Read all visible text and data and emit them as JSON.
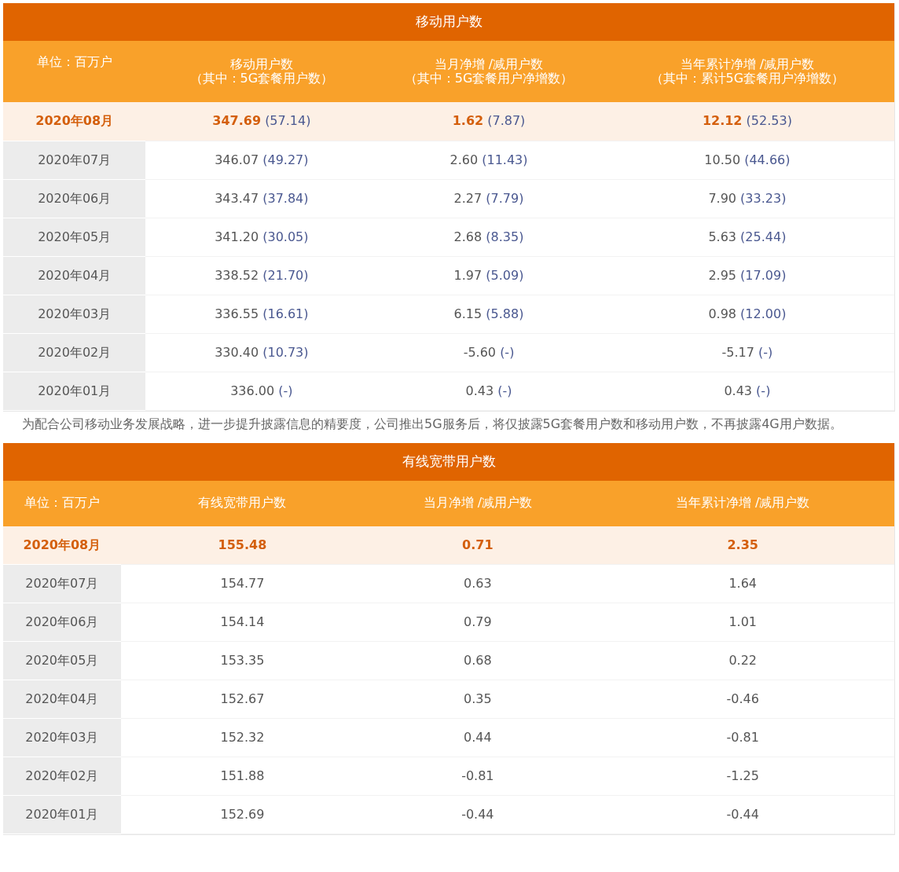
{
  "tables": [
    {
      "title": "移动用户数",
      "columns": [
        {
          "lines": [
            "单位：百万户"
          ]
        },
        {
          "lines": [
            "移动用户数",
            "（其中：5G套餐用户数）"
          ]
        },
        {
          "lines": [
            "当月净增 /减用户数",
            "（其中：5G套餐用户净增数）"
          ]
        },
        {
          "lines": [
            "当年累计净增 /减用户数",
            "（其中：累计5G套餐用户净增数）"
          ]
        }
      ],
      "rows": [
        {
          "highlighted": true,
          "cells": [
            {
              "value": "2020年08月"
            },
            {
              "value": "347.69",
              "sub": "(57.14)"
            },
            {
              "value": "1.62",
              "sub": "(7.87)"
            },
            {
              "value": "12.12",
              "sub": "(52.53)"
            }
          ]
        },
        {
          "highlighted": false,
          "cells": [
            {
              "value": "2020年07月"
            },
            {
              "value": "346.07",
              "sub": "(49.27)"
            },
            {
              "value": "2.60",
              "sub": "(11.43)"
            },
            {
              "value": "10.50",
              "sub": "(44.66)"
            }
          ]
        },
        {
          "highlighted": false,
          "cells": [
            {
              "value": "2020年06月"
            },
            {
              "value": "343.47",
              "sub": "(37.84)"
            },
            {
              "value": "2.27",
              "sub": "(7.79)"
            },
            {
              "value": "7.90",
              "sub": "(33.23)"
            }
          ]
        },
        {
          "highlighted": false,
          "cells": [
            {
              "value": "2020年05月"
            },
            {
              "value": "341.20",
              "sub": "(30.05)"
            },
            {
              "value": "2.68",
              "sub": "(8.35)"
            },
            {
              "value": "5.63",
              "sub": "(25.44)"
            }
          ]
        },
        {
          "highlighted": false,
          "cells": [
            {
              "value": "2020年04月"
            },
            {
              "value": "338.52",
              "sub": "(21.70)"
            },
            {
              "value": "1.97",
              "sub": "(5.09)"
            },
            {
              "value": "2.95",
              "sub": "(17.09)"
            }
          ]
        },
        {
          "highlighted": false,
          "cells": [
            {
              "value": "2020年03月"
            },
            {
              "value": "336.55",
              "sub": "(16.61)"
            },
            {
              "value": "6.15",
              "sub": "(5.88)"
            },
            {
              "value": "0.98",
              "sub": "(12.00)"
            }
          ]
        },
        {
          "highlighted": false,
          "cells": [
            {
              "value": "2020年02月"
            },
            {
              "value": "330.40",
              "sub": "(10.73)"
            },
            {
              "value": "-5.60",
              "sub": "(-)"
            },
            {
              "value": "-5.17",
              "sub": "(-)"
            }
          ]
        },
        {
          "highlighted": false,
          "cells": [
            {
              "value": "2020年01月"
            },
            {
              "value": "336.00",
              "sub": "(-)"
            },
            {
              "value": "0.43",
              "sub": "(-)"
            },
            {
              "value": "0.43",
              "sub": "(-)"
            }
          ]
        }
      ],
      "note": "为配合公司移动业务发展战略，进一步提升披露信息的精要度，公司推出5G服务后，将仅披露5G套餐用户数和移动用户数，不再披露4G用户数据。"
    },
    {
      "title": "有线宽带用户数",
      "columns": [
        {
          "lines": [
            "单位：百万户"
          ]
        },
        {
          "lines": [
            "有线宽带用户数"
          ]
        },
        {
          "lines": [
            "当月净增 /减用户数"
          ]
        },
        {
          "lines": [
            "当年累计净增 /减用户数"
          ]
        }
      ],
      "rows": [
        {
          "highlighted": true,
          "cells": [
            {
              "value": "2020年08月"
            },
            {
              "value": "155.48"
            },
            {
              "value": "0.71"
            },
            {
              "value": "2.35"
            }
          ]
        },
        {
          "highlighted": false,
          "cells": [
            {
              "value": "2020年07月"
            },
            {
              "value": "154.77"
            },
            {
              "value": "0.63"
            },
            {
              "value": "1.64"
            }
          ]
        },
        {
          "highlighted": false,
          "cells": [
            {
              "value": "2020年06月"
            },
            {
              "value": "154.14"
            },
            {
              "value": "0.79"
            },
            {
              "value": "1.01"
            }
          ]
        },
        {
          "highlighted": false,
          "cells": [
            {
              "value": "2020年05月"
            },
            {
              "value": "153.35"
            },
            {
              "value": "0.68"
            },
            {
              "value": "0.22"
            }
          ]
        },
        {
          "highlighted": false,
          "cells": [
            {
              "value": "2020年04月"
            },
            {
              "value": "152.67"
            },
            {
              "value": "0.35"
            },
            {
              "value": "-0.46"
            }
          ]
        },
        {
          "highlighted": false,
          "cells": [
            {
              "value": "2020年03月"
            },
            {
              "value": "152.32"
            },
            {
              "value": "0.44"
            },
            {
              "value": "-0.81"
            }
          ]
        },
        {
          "highlighted": false,
          "cells": [
            {
              "value": "2020年02月"
            },
            {
              "value": "151.88"
            },
            {
              "value": "-0.81"
            },
            {
              "value": "-1.25"
            }
          ]
        },
        {
          "highlighted": false,
          "cells": [
            {
              "value": "2020年01月"
            },
            {
              "value": "152.69"
            },
            {
              "value": "-0.44"
            },
            {
              "value": "-0.44"
            }
          ]
        }
      ]
    }
  ]
}
